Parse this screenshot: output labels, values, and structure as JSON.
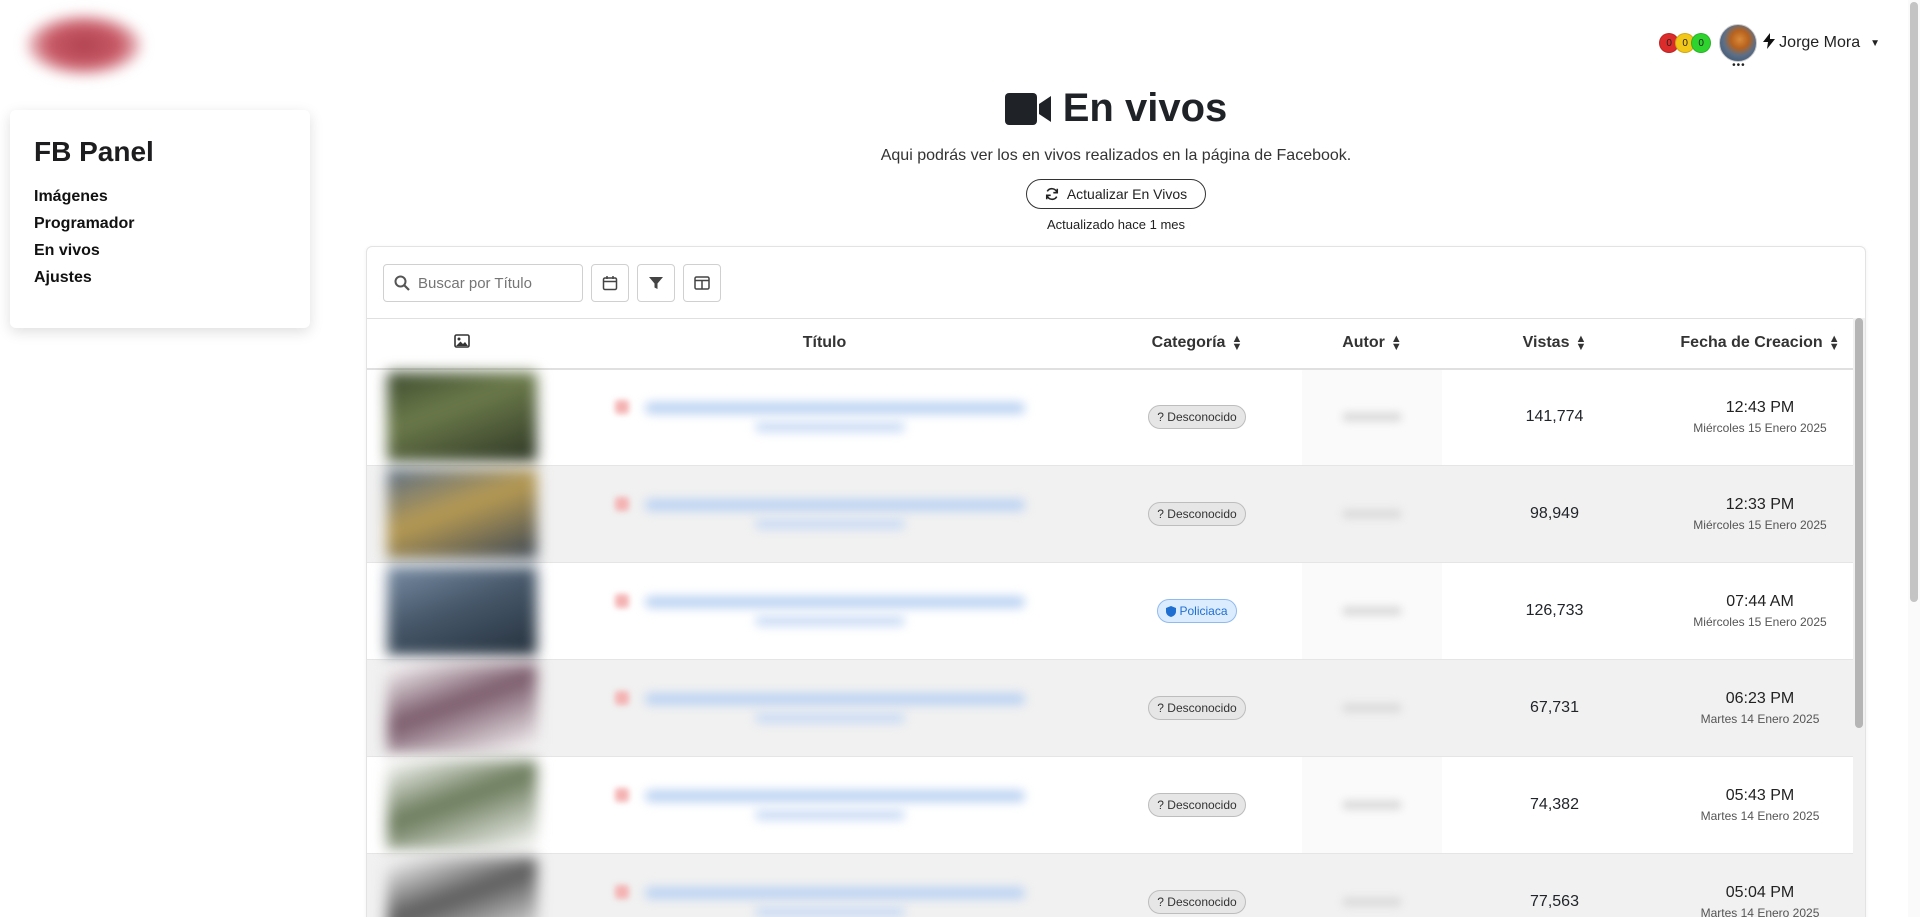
{
  "sidebar": {
    "title": "FB Panel",
    "items": [
      {
        "label": "Imágenes"
      },
      {
        "label": "Programador"
      },
      {
        "label": "En vivos"
      },
      {
        "label": "Ajustes"
      }
    ]
  },
  "topbar": {
    "counters": [
      "0",
      "0",
      "0"
    ],
    "user_name": "Jorge Mora",
    "icons": [
      "bolt-icon",
      "caret-down-icon"
    ]
  },
  "header": {
    "title": "En vivos",
    "title_icon": "video-camera-icon",
    "subtitle": "Aqui podrás ver los en vivos realizados en la página de Facebook.",
    "refresh_label": "Actualizar En Vivos",
    "updated_text": "Actualizado hace 1 mes"
  },
  "toolbar": {
    "search_placeholder": "Buscar por Título",
    "icons": [
      "calendar-icon",
      "filter-icon",
      "columns-icon"
    ]
  },
  "table": {
    "columns": [
      "",
      "Título",
      "Categoría",
      "Autor",
      "Vistas",
      "Fecha de Creacion"
    ],
    "rows": [
      {
        "category": "? Desconocido",
        "category_type": "unknown",
        "views": "141,774",
        "time": "12:43 PM",
        "date": "Miércoles 15 Enero 2025"
      },
      {
        "category": "? Desconocido",
        "category_type": "unknown",
        "views": "98,949",
        "time": "12:33 PM",
        "date": "Miércoles 15 Enero 2025"
      },
      {
        "category": "Policiaca",
        "category_type": "police",
        "views": "126,733",
        "time": "07:44 AM",
        "date": "Miércoles 15 Enero 2025"
      },
      {
        "category": "? Desconocido",
        "category_type": "unknown",
        "views": "67,731",
        "time": "06:23 PM",
        "date": "Martes 14 Enero 2025"
      },
      {
        "category": "? Desconocido",
        "category_type": "unknown",
        "views": "74,382",
        "time": "05:43 PM",
        "date": "Martes 14 Enero 2025"
      },
      {
        "category": "? Desconocido",
        "category_type": "unknown",
        "views": "77,563",
        "time": "05:04 PM",
        "date": "Martes 14 Enero 2025"
      }
    ]
  },
  "colors": {
    "counter_red": "#dc2b2b",
    "counter_yellow": "#f3c718",
    "counter_green": "#2ed32e",
    "police_badge": "#1f6fd1"
  }
}
